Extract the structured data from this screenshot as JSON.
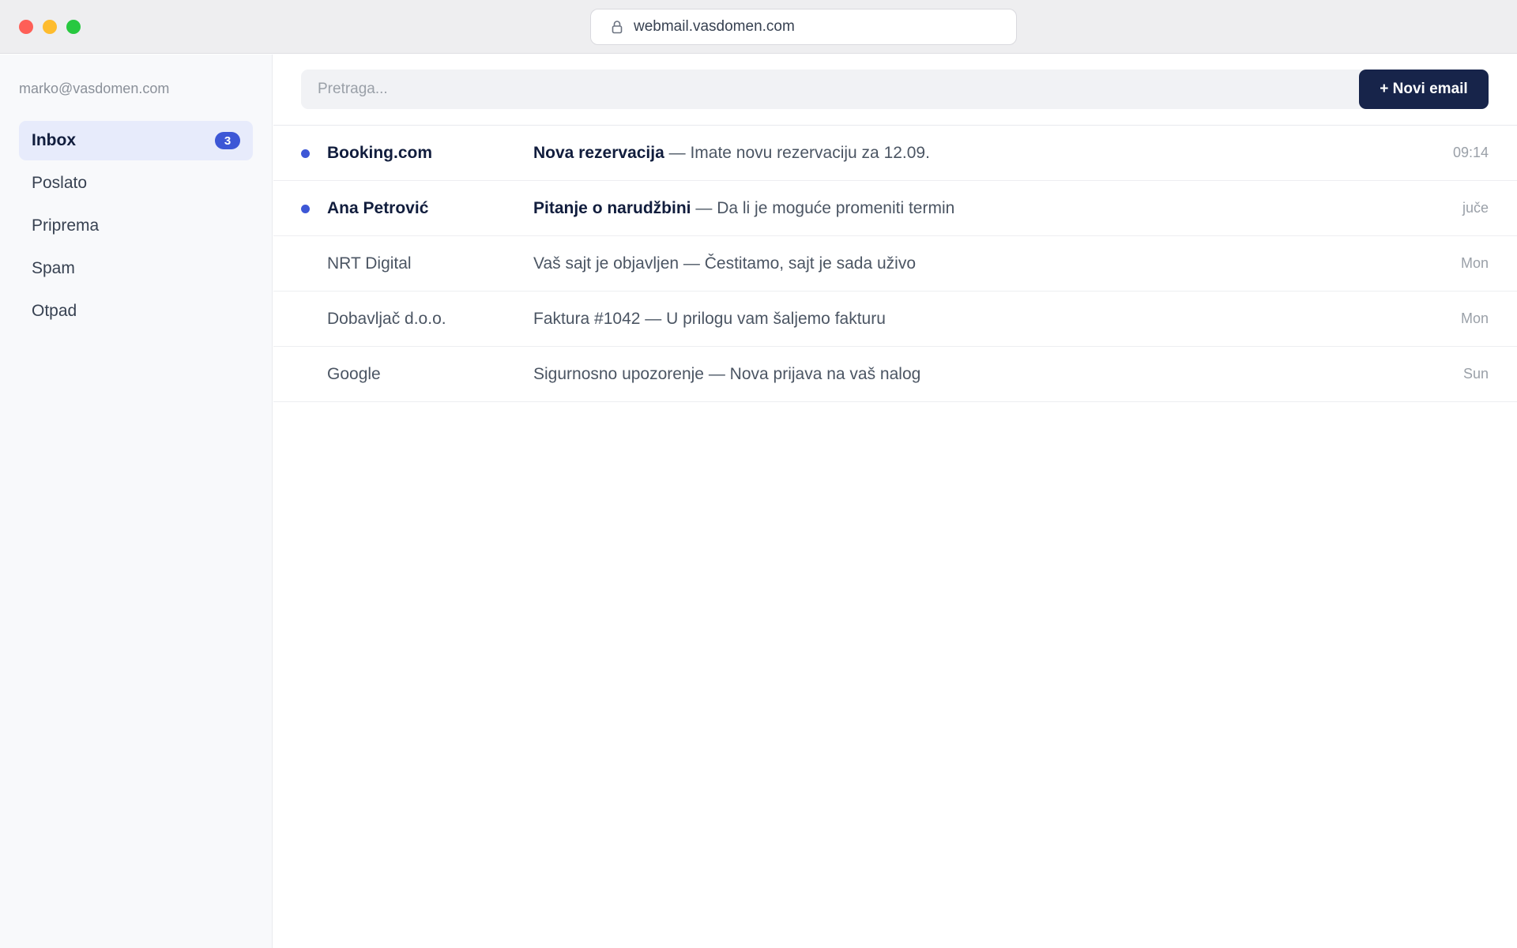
{
  "browser": {
    "url": "webmail.vasdomen.com"
  },
  "sidebar": {
    "account": "marko@vasdomen.com",
    "folders": [
      {
        "label": "Inbox",
        "count": "3",
        "active": true
      },
      {
        "label": "Poslato"
      },
      {
        "label": "Priprema"
      },
      {
        "label": "Spam"
      },
      {
        "label": "Otpad"
      }
    ]
  },
  "toolbar": {
    "search_placeholder": "Pretraga...",
    "compose_label": "+ Novi email"
  },
  "messages": [
    {
      "sender": "Booking.com",
      "subject": "Nova rezervacija",
      "separator": " — ",
      "preview": "Imate novu rezervaciju za 12.09.",
      "date": "09:14",
      "unread": true
    },
    {
      "sender": "Ana Petrović",
      "subject": "Pitanje o narudžbini",
      "separator": " — ",
      "preview": "Da li je moguće promeniti termin",
      "date": "juče",
      "unread": true
    },
    {
      "sender": "NRT Digital",
      "subject": "Vaš sajt je objavljen",
      "separator": " — ",
      "preview": "Čestitamo, sajt je sada uživo",
      "date": "Mon",
      "unread": false
    },
    {
      "sender": "Dobavljač d.o.o.",
      "subject": "Faktura #1042",
      "separator": " — ",
      "preview": "U prilogu vam šaljemo fakturu",
      "date": "Mon",
      "unread": false
    },
    {
      "sender": "Google",
      "subject": "Sigurnosno upozorenje",
      "separator": " — ",
      "preview": "Nova prijava na vaš nalog",
      "date": "Sun",
      "unread": false
    }
  ],
  "colors": {
    "accent": "#3d57d6",
    "compose_bg": "#17244a",
    "active_folder_bg": "#e7ebfb"
  }
}
